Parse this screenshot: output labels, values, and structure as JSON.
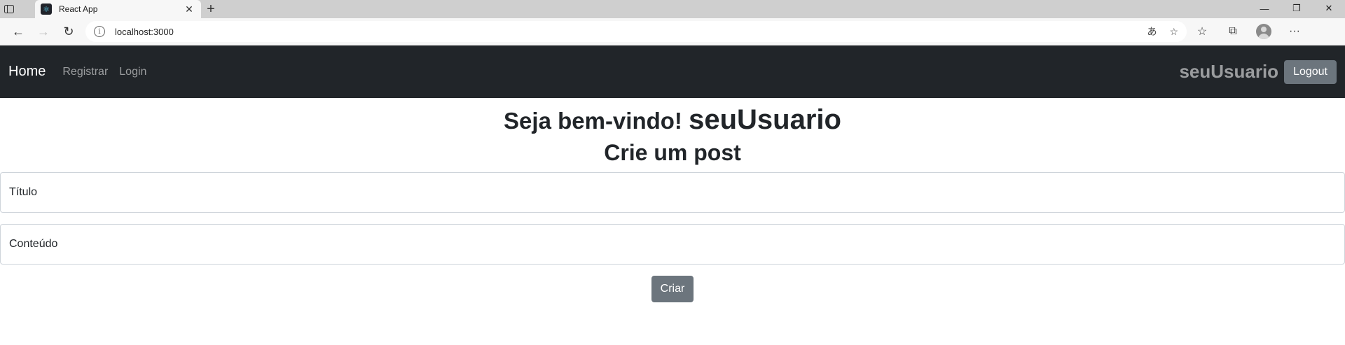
{
  "browser": {
    "tab_title": "React App",
    "url": "localhost:3000",
    "new_tab_symbol": "+",
    "icons": [
      "tab-actions-icon",
      "react-favicon",
      "close-tab-icon",
      "back-icon",
      "forward-icon",
      "refresh-icon",
      "site-info-icon",
      "read-aloud-icon",
      "add-favorite-icon",
      "favorites-icon",
      "collections-icon",
      "profile-icon",
      "more-icon",
      "minimize-icon",
      "restore-icon",
      "close-window-icon"
    ]
  },
  "navbar": {
    "brand": "Home",
    "links": [
      "Registrar",
      "Login"
    ],
    "username": "seuUsuario",
    "logout_label": "Logout",
    "background": "#212529"
  },
  "main": {
    "welcome_text": "Seja bem-vindo!",
    "welcome_user": "seuUsuario",
    "form_title": "Crie um post",
    "title_placeholder": "Título",
    "content_placeholder": "Conteúdo",
    "submit_label": "Criar"
  },
  "colors": {
    "button_secondary": "#6c757d",
    "text": "#212529"
  }
}
